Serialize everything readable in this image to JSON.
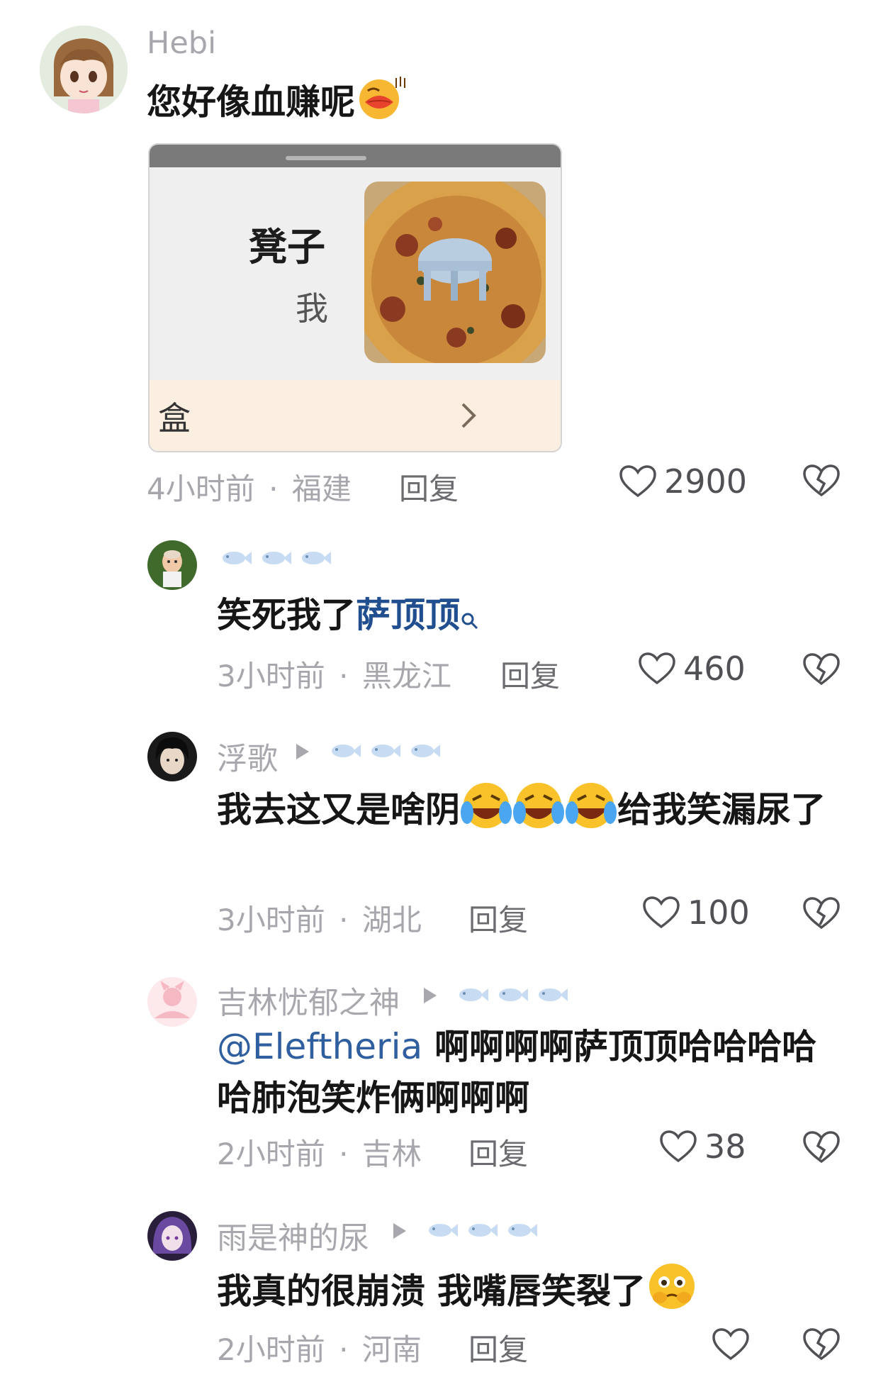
{
  "comments": [
    {
      "username": "Hebi",
      "text": "您好像血赚呢",
      "image": {
        "title": "凳子",
        "subtitle": "我",
        "bottom_text": "盒"
      },
      "time": "4小时前",
      "location": "福建",
      "reply_label": "回复",
      "likes": "2900"
    },
    {
      "username": "",
      "text_before": "笑死我了",
      "topic": "萨顶顶",
      "time": "3小时前",
      "location": "黑龙江",
      "reply_label": "回复",
      "likes": "460"
    },
    {
      "username": "浮歌",
      "text_before": "我去这又是啥阴",
      "text_after": "给我笑漏尿了",
      "time": "3小时前",
      "location": "湖北",
      "reply_label": "回复",
      "likes": "100"
    },
    {
      "username": "吉林忧郁之神",
      "mention": "@Eleftheria",
      "text": " 啊啊啊啊萨顶顶哈哈哈哈哈肺泡笑炸俩啊啊啊",
      "time": "2小时前",
      "location": "吉林",
      "reply_label": "回复",
      "likes": "38"
    },
    {
      "username": "雨是神的尿",
      "text": "我真的很崩溃 我嘴唇笑裂了",
      "time": "2小时前",
      "location": "河南",
      "reply_label": "回复",
      "likes": ""
    }
  ],
  "separator": "·",
  "icons": {
    "heart": "heart-icon",
    "dislike": "broken-heart-icon",
    "fish_badge": "fish-icon",
    "play": "play-triangle-icon",
    "search": "search-icon"
  },
  "colors": {
    "meta_gray": "#a6a6ac",
    "mention_blue": "#2f5f9f"
  }
}
